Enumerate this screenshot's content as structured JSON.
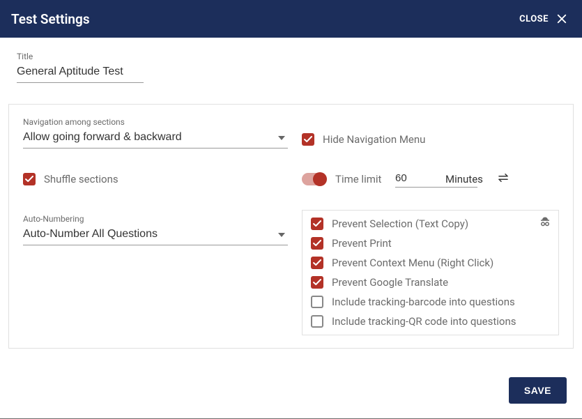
{
  "header": {
    "title": "Test Settings",
    "close_label": "CLOSE"
  },
  "title_field": {
    "label": "Title",
    "value": "General Aptitude Test"
  },
  "navigation": {
    "label": "Navigation among sections",
    "value": "Allow going forward & backward"
  },
  "hide_nav": {
    "label": "Hide Navigation Menu",
    "checked": true
  },
  "shuffle": {
    "label": "Shuffle sections",
    "checked": true
  },
  "time_limit": {
    "enabled": true,
    "label": "Time limit",
    "value": "60",
    "unit": "Minutes"
  },
  "auto_numbering": {
    "label": "Auto-Numbering",
    "value": "Auto-Number All Questions"
  },
  "security": {
    "items": [
      {
        "label": "Prevent Selection (Text Copy)",
        "checked": true
      },
      {
        "label": "Prevent Print",
        "checked": true
      },
      {
        "label": "Prevent Context Menu (Right Click)",
        "checked": true
      },
      {
        "label": "Prevent Google Translate",
        "checked": true
      },
      {
        "label": "Include tracking-barcode into questions",
        "checked": false
      },
      {
        "label": "Include tracking-QR code into questions",
        "checked": false
      }
    ]
  },
  "footer": {
    "save_label": "SAVE"
  }
}
